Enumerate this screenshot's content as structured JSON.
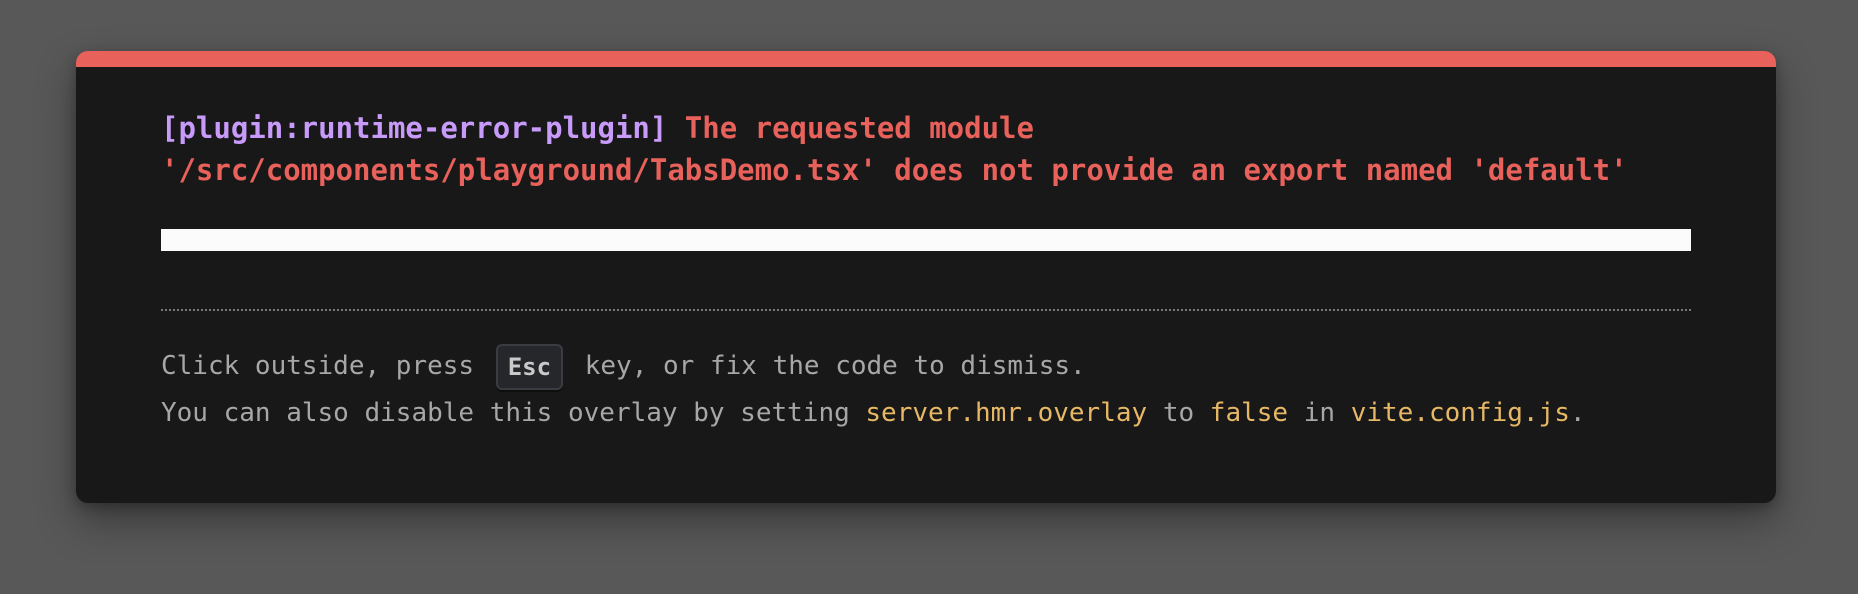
{
  "error": {
    "plugin_tag": "[plugin:runtime-error-plugin]",
    "message": " The requested module '/src/components/playground/TabsDemo.tsx' does not provide an export named 'default'"
  },
  "tip": {
    "line1_prefix": "Click outside, press ",
    "line1_key": "Esc",
    "line1_suffix": " key, or fix the code to dismiss.",
    "line2_text1": "You can also disable this overlay by setting ",
    "line2_code1": "server.hmr.overlay",
    "line2_text2": " to ",
    "line2_code2": "false",
    "line2_text3": " in ",
    "line2_code3": "vite.config.js",
    "line2_text4": "."
  },
  "colors": {
    "accent_red": "#e8615b",
    "plugin_purple": "#c89bfa",
    "code_yellow": "#e6b866",
    "panel_bg": "#181818",
    "page_bg": "#585858"
  }
}
